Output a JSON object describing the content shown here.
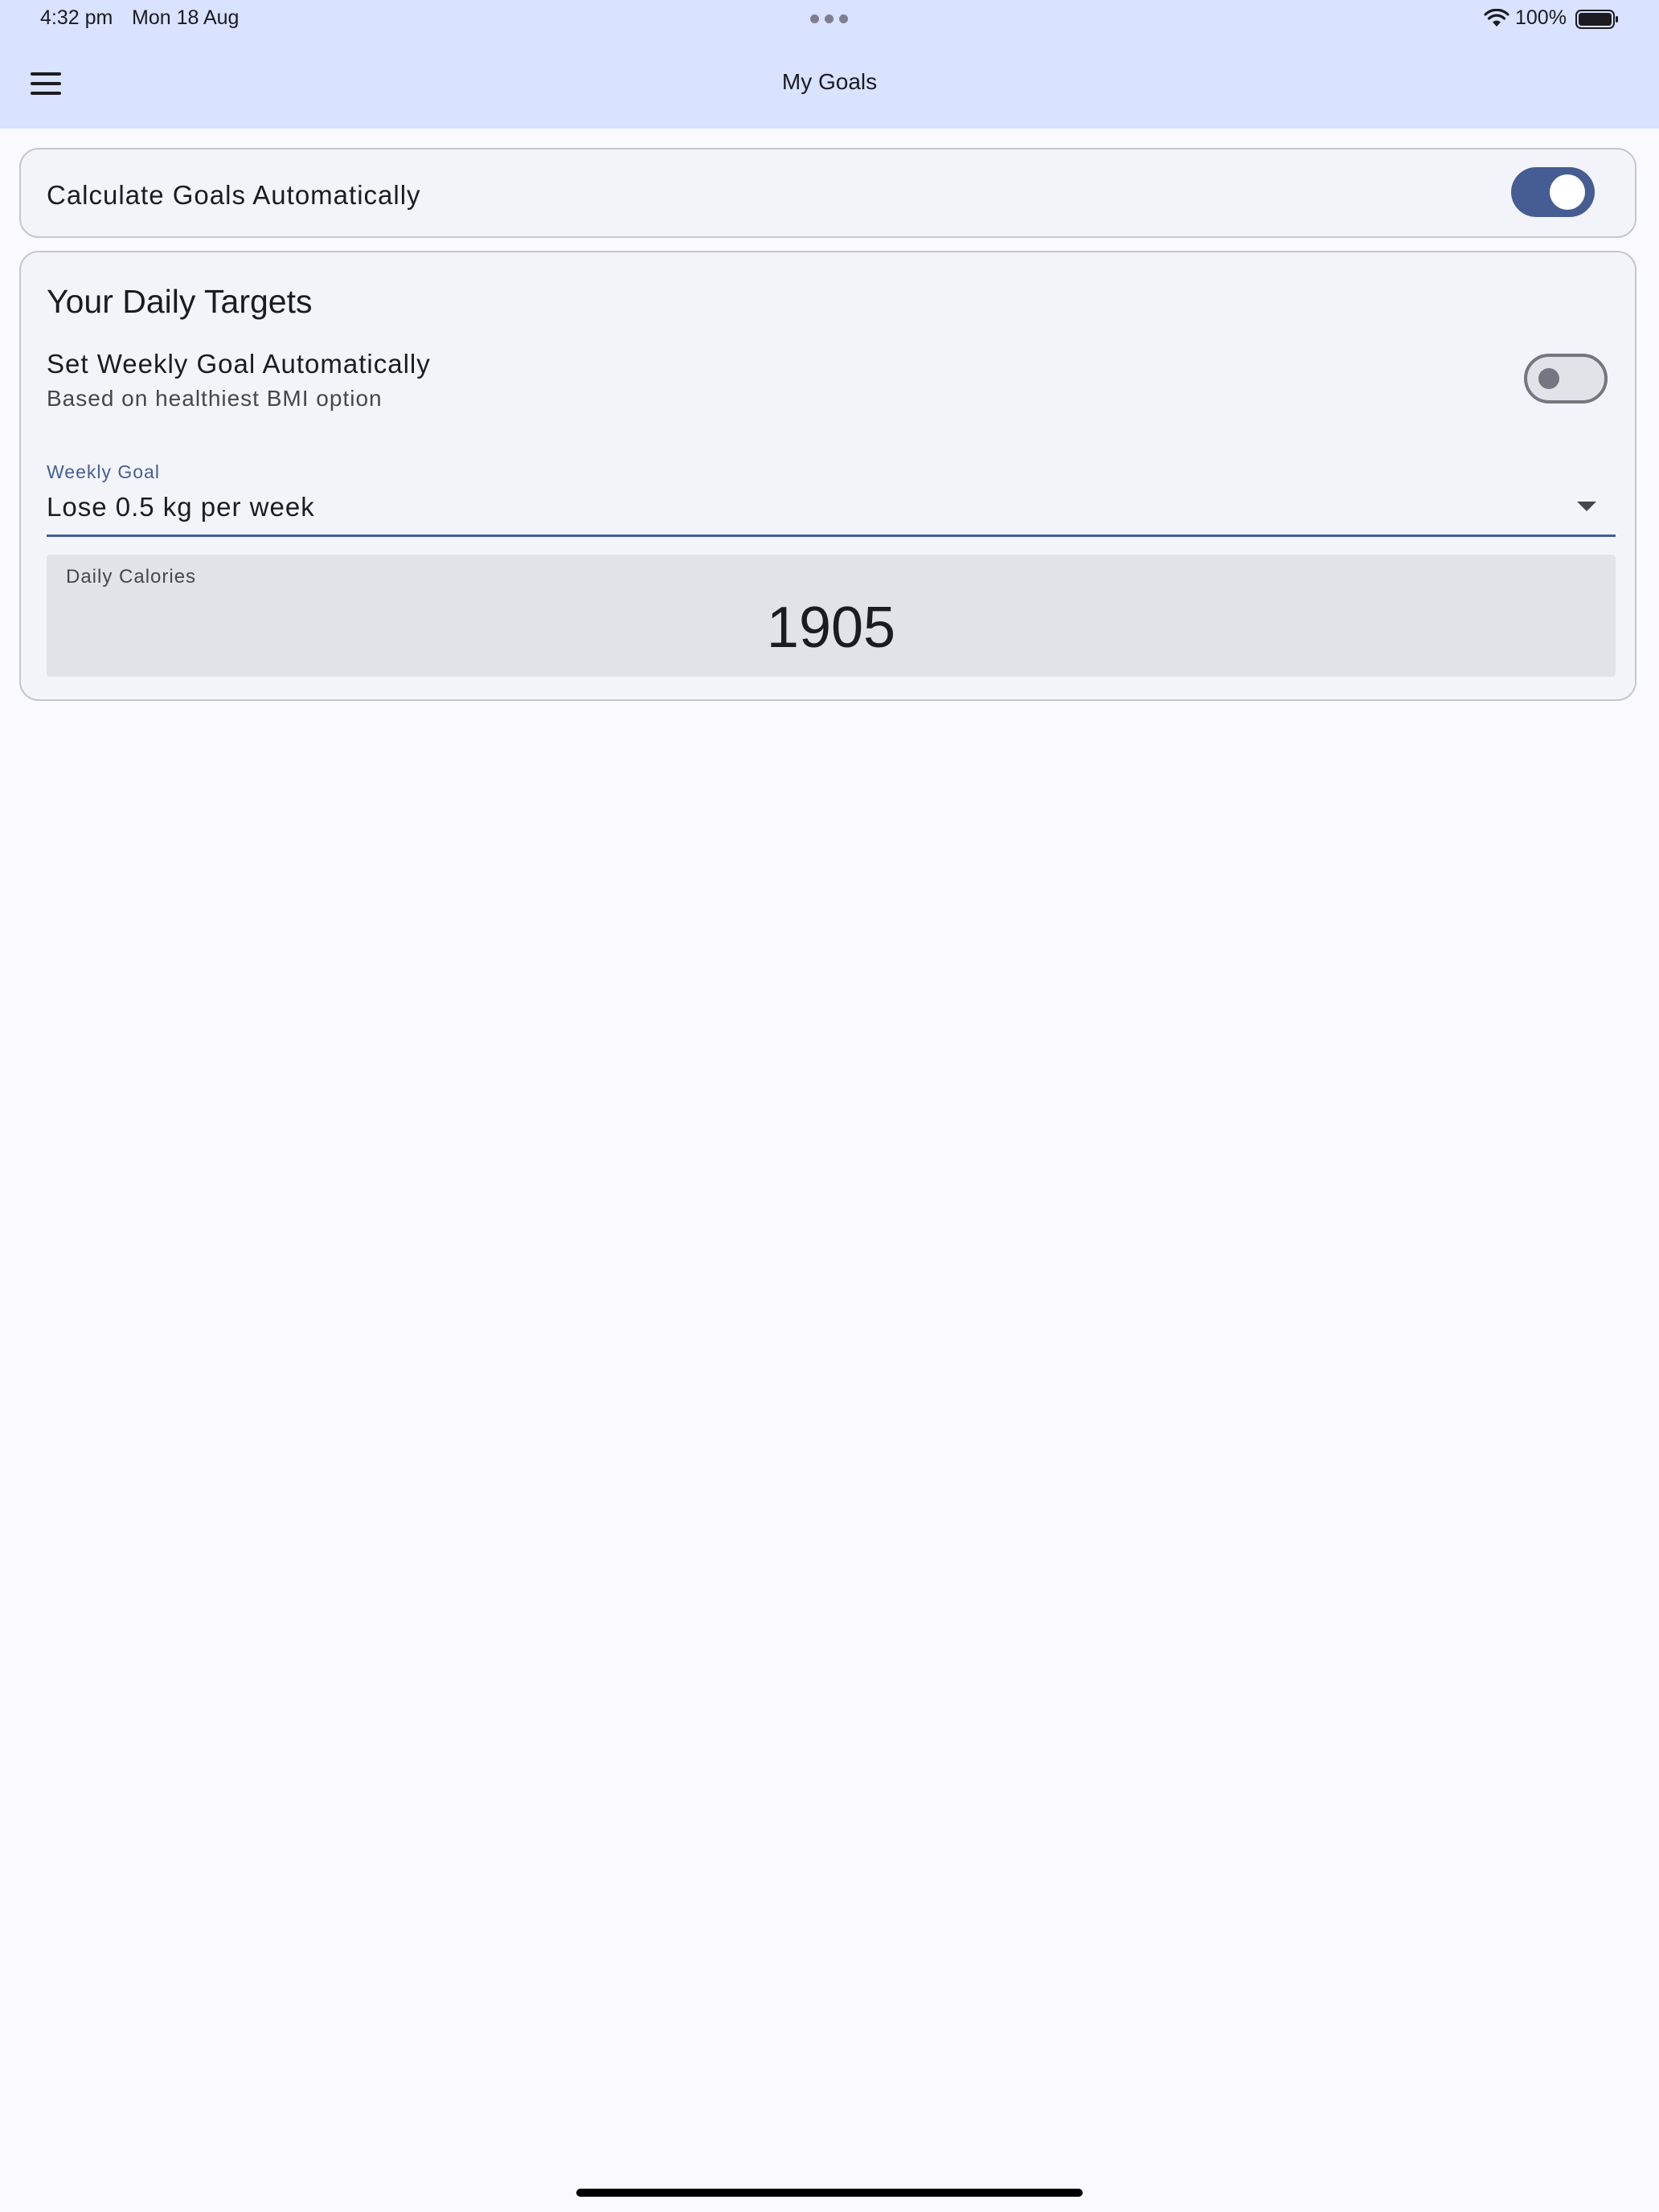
{
  "status_bar": {
    "time": "4:32 pm",
    "date": "Mon 18 Aug",
    "battery": "100%",
    "icons": [
      "wifi-icon",
      "battery-icon",
      "more-dots-icon"
    ]
  },
  "app_bar": {
    "title": "My Goals",
    "menu_icon": "hamburger-menu-icon"
  },
  "auto_goals_card": {
    "label": "Calculate Goals Automatically",
    "toggle_on": true
  },
  "targets_card": {
    "title": "Your Daily Targets",
    "weekly_auto": {
      "label": "Set Weekly Goal Automatically",
      "subtitle": "Based on healthiest BMI option",
      "toggle_on": false
    },
    "weekly_goal": {
      "label": "Weekly Goal",
      "value": "Lose 0.5 kg per week"
    },
    "daily_calories": {
      "label": "Daily Calories",
      "value": "1905"
    }
  },
  "colors": {
    "app_bar": "#d9e2ff",
    "primary": "#455d93",
    "background": "#f9f9ff",
    "card": "#f3f4f9"
  }
}
